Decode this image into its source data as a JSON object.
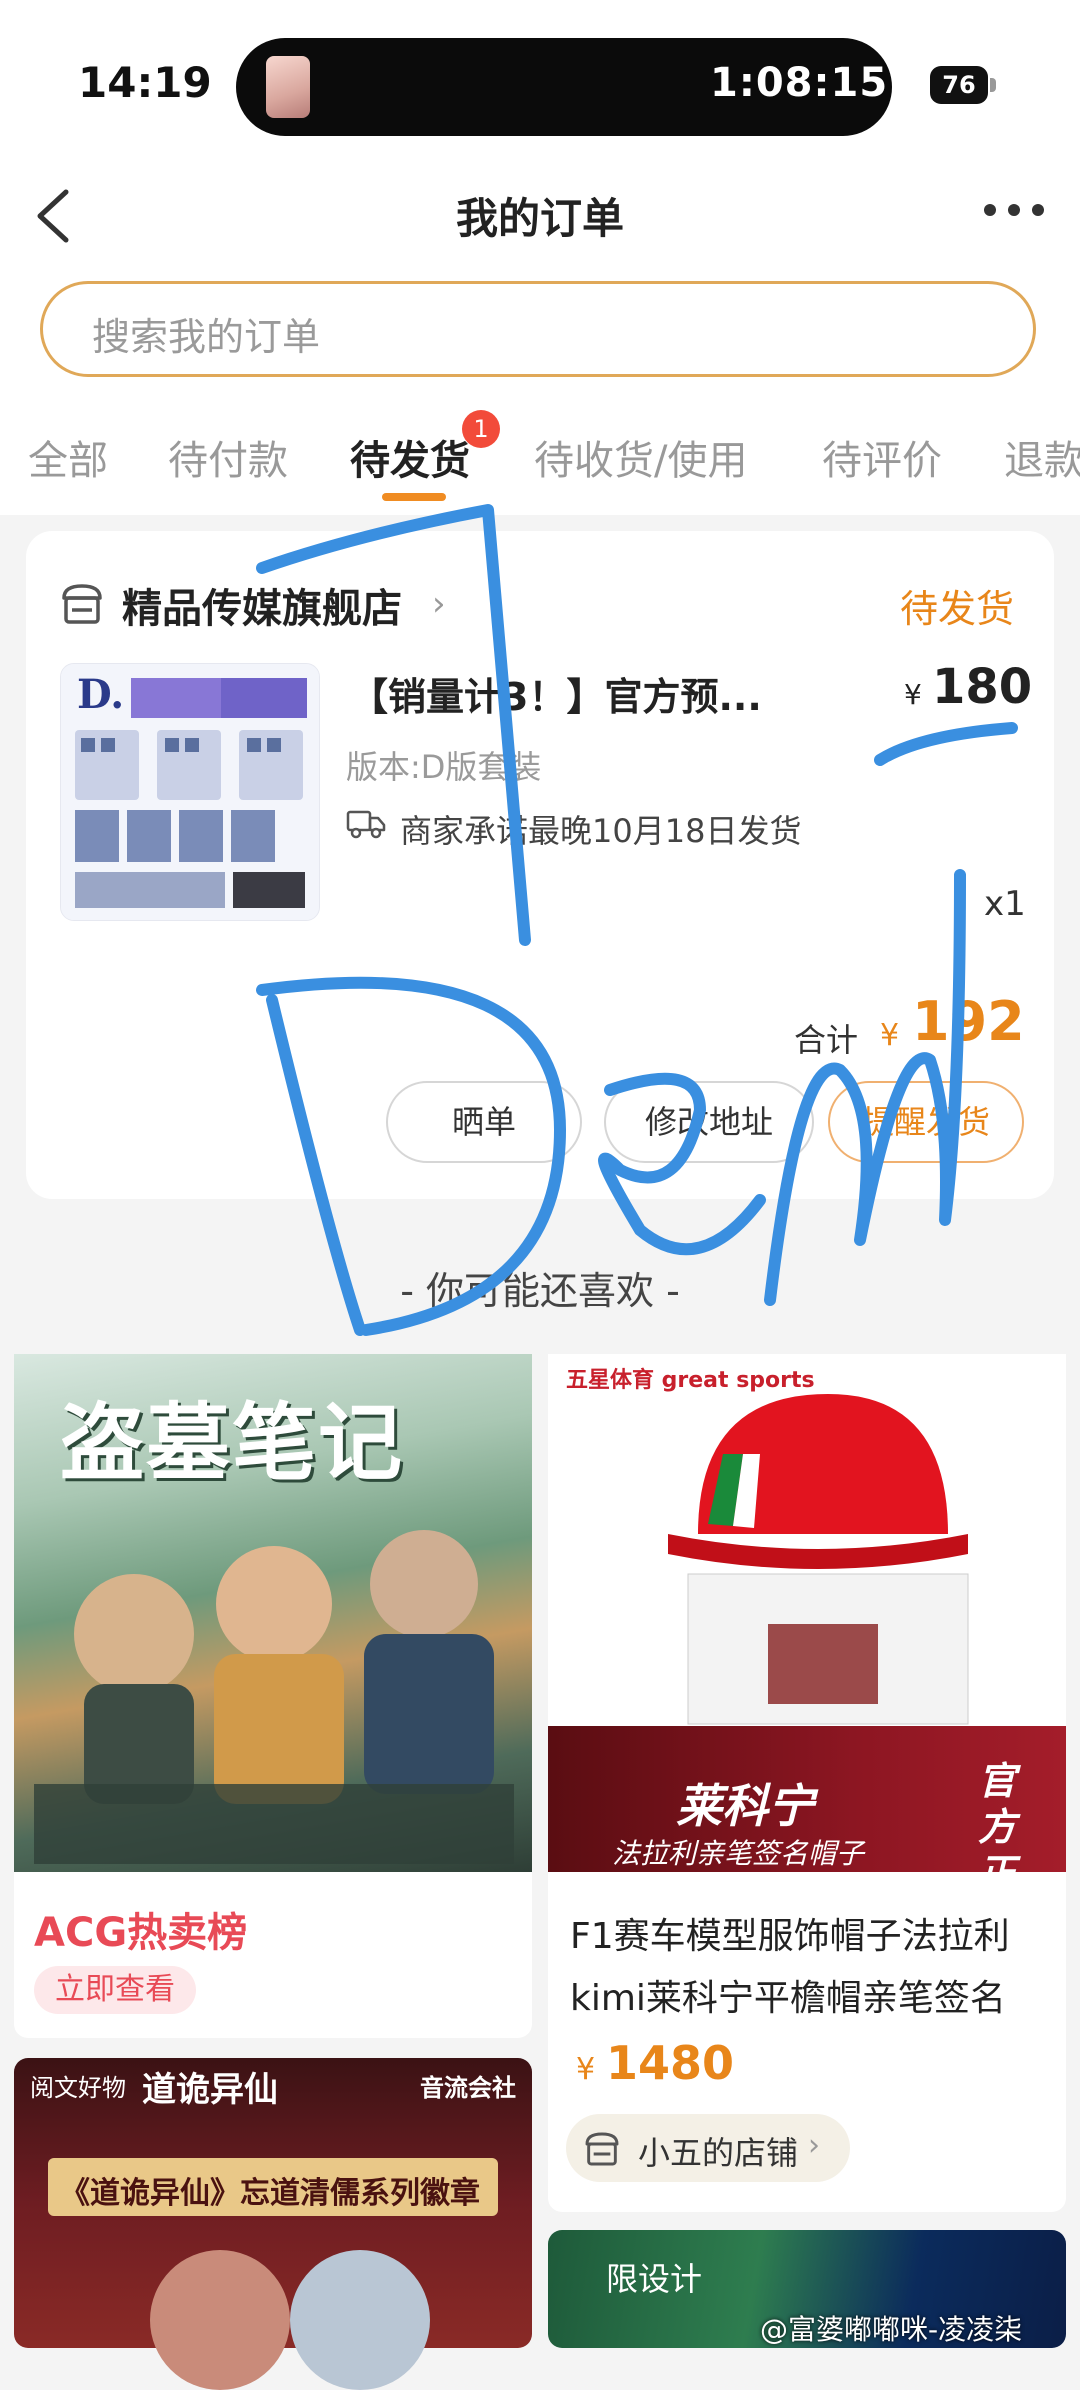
{
  "status_bar": {
    "time": "14:19",
    "timer": "1:08:15",
    "battery": "76"
  },
  "nav": {
    "title": "我的订单"
  },
  "search": {
    "placeholder": "搜索我的订单"
  },
  "tabs": [
    {
      "label": "全部"
    },
    {
      "label": "待付款"
    },
    {
      "label": "待发货",
      "active": true,
      "badge": "1"
    },
    {
      "label": "待收货/使用"
    },
    {
      "label": "待评价"
    },
    {
      "label": "退款"
    }
  ],
  "order": {
    "shop_name": "精品传媒旗舰店",
    "status": "待发货",
    "title": "【销量计3！】官方预...",
    "price_symbol": "¥",
    "price": "180",
    "variant": "版本:D版套装",
    "promise": "商家承诺最晚10月18日发货",
    "quantity": "x1",
    "total_label": "合计",
    "total_symbol": "¥",
    "total": "192",
    "buttons": [
      "晒单",
      "修改地址",
      "提醒发货"
    ]
  },
  "recommend": {
    "heading": "- 你可能还喜欢 -",
    "acg": {
      "image_title": "盗墓笔记",
      "label": "ACG热卖榜",
      "cta": "立即查看"
    },
    "cap": {
      "brand": "五星体育 great sports",
      "banner_name": "莱科宁",
      "banner_sub": "法拉利亲笔签名帽子",
      "official": "官方正品",
      "description": "F1赛车模型服饰帽子法拉利kimi莱科宁平檐帽亲笔签名",
      "price_symbol": "¥",
      "price": "1480",
      "shop": "小五的店铺"
    },
    "daogui": {
      "brand": "阅文好物",
      "logo": "道诡异仙",
      "right": "音流会社",
      "band": "《道诡异仙》忘道清儒系列徽章"
    },
    "last": {
      "text": "限设计"
    }
  },
  "watermark": "@富婆嘟嘟咪-凌凌柒",
  "overlay": {
    "scribble_text": "7 Dem"
  },
  "colors": {
    "accent": "#e8861a",
    "badge": "#f24b3a",
    "acg_red": "#e84a56",
    "scribble": "#3a8fe0"
  }
}
